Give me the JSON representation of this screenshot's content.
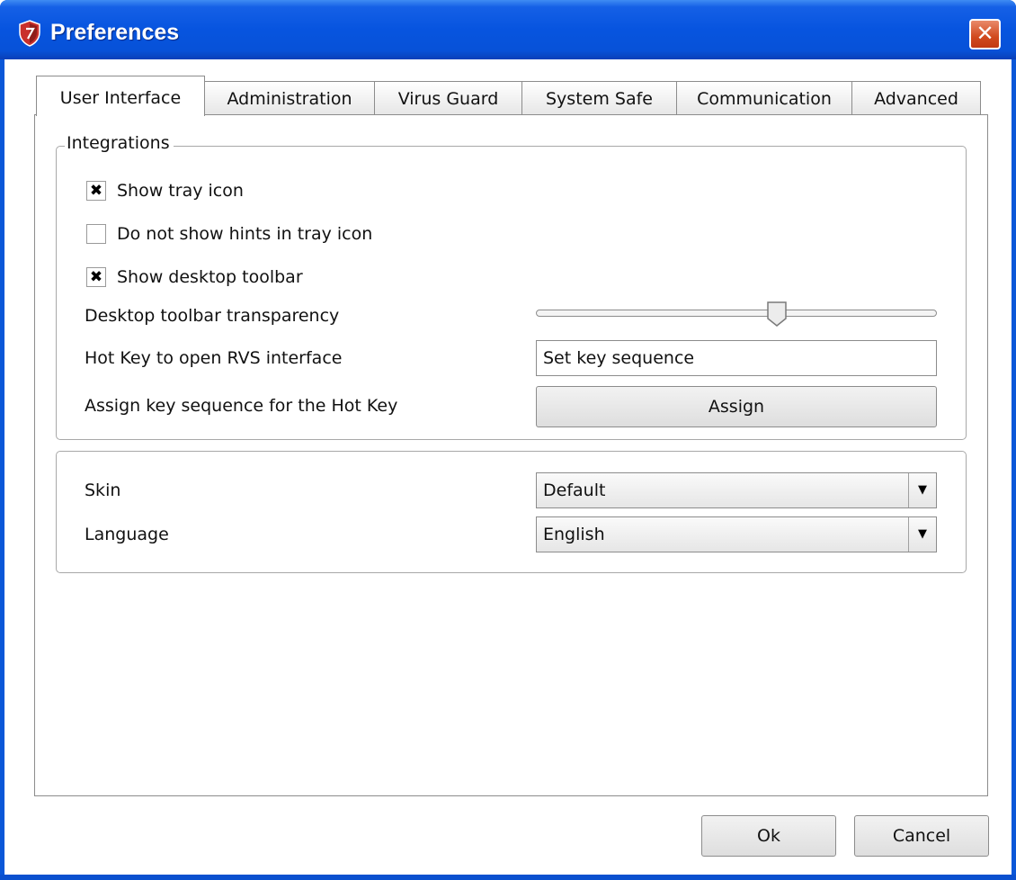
{
  "window": {
    "title": "Preferences",
    "close_glyph": "✕",
    "app_icon": "shield-icon"
  },
  "tabs": [
    {
      "label": "User Interface",
      "active": true
    },
    {
      "label": "Administration",
      "active": false
    },
    {
      "label": "Virus Guard",
      "active": false
    },
    {
      "label": "System Safe",
      "active": false
    },
    {
      "label": "Communication",
      "active": false
    },
    {
      "label": "Advanced",
      "active": false
    }
  ],
  "integrations": {
    "legend": "Integrations",
    "show_tray_icon": {
      "label": "Show tray icon",
      "checked": true,
      "mark": "✖"
    },
    "no_hints": {
      "label": "Do not show hints in tray icon",
      "checked": false,
      "mark": ""
    },
    "show_toolbar": {
      "label": "Show desktop toolbar",
      "checked": true,
      "mark": "✖"
    },
    "transparency": {
      "label": "Desktop toolbar transparency",
      "value": 0.6
    },
    "hotkey": {
      "label": "Hot Key to open RVS interface",
      "value": "Set key sequence"
    },
    "assign": {
      "label": "Assign key sequence for the Hot Key",
      "button": "Assign"
    }
  },
  "appearance": {
    "skin": {
      "label": "Skin",
      "value": "Default"
    },
    "language": {
      "label": "Language",
      "value": "English"
    },
    "arrow_glyph": "▼"
  },
  "footer": {
    "ok": "Ok",
    "cancel": "Cancel"
  },
  "colors": {
    "titlebar": "#0754df",
    "close": "#d14a1f"
  }
}
